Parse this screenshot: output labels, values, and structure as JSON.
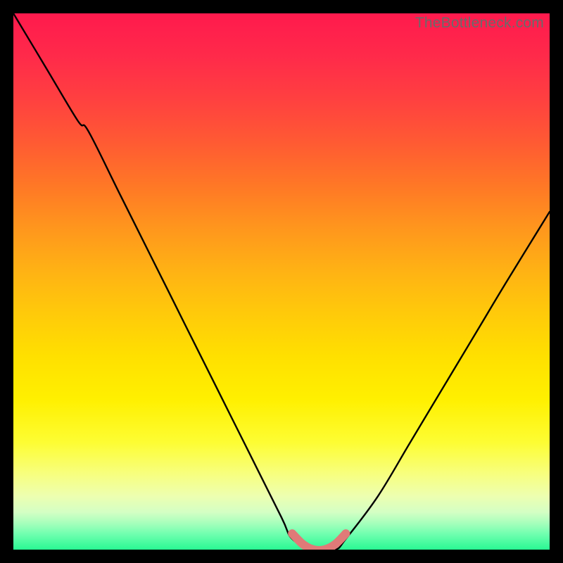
{
  "watermark": "TheBottleneck.com",
  "colors": {
    "background": "#000000",
    "curve": "#000000",
    "flat_marker": "#e07a78"
  },
  "chart_data": {
    "type": "line",
    "title": "",
    "xlabel": "",
    "ylabel": "",
    "xlim": [
      0,
      100
    ],
    "ylim": [
      0,
      100
    ],
    "series": [
      {
        "name": "bottleneck-curve",
        "x": [
          0,
          6,
          12,
          14,
          20,
          26,
          32,
          38,
          44,
          50,
          52,
          56,
          60,
          62,
          68,
          74,
          80,
          86,
          92,
          100
        ],
        "values": [
          100,
          90,
          80,
          78,
          66,
          54,
          42,
          30,
          18,
          6,
          2,
          0,
          0,
          2,
          10,
          20,
          30,
          40,
          50,
          63
        ]
      },
      {
        "name": "flat-minimum-marker",
        "x": [
          52,
          54,
          56,
          58,
          60,
          62
        ],
        "values": [
          3,
          1,
          0,
          0,
          1,
          3
        ]
      }
    ]
  }
}
